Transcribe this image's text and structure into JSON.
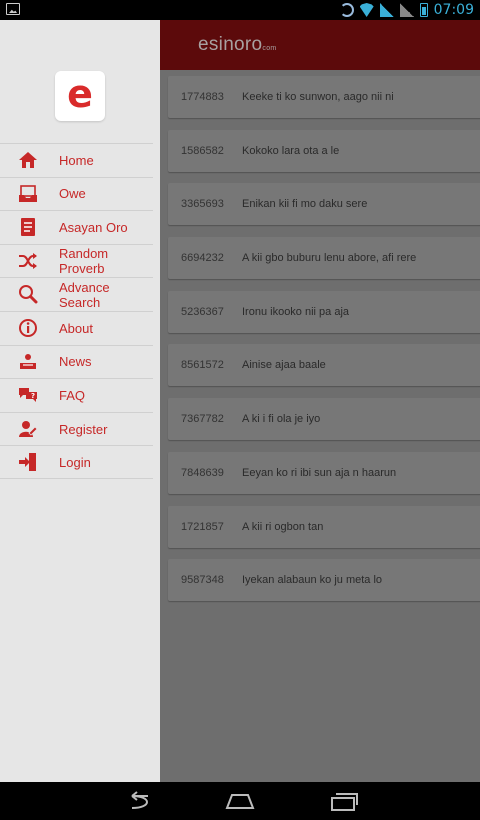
{
  "status": {
    "time": "07:09"
  },
  "app": {
    "brand_main": "esinoro",
    "brand_suffix": "com"
  },
  "drawer": {
    "logo_letter": "e",
    "items": [
      {
        "label": "Home",
        "icon": "home-icon"
      },
      {
        "label": "Owe",
        "icon": "inbox-icon"
      },
      {
        "label": "Asayan Oro",
        "icon": "list-icon"
      },
      {
        "label": "Random Proverb",
        "icon": "shuffle-icon"
      },
      {
        "label": "Advance Search",
        "icon": "search-icon"
      },
      {
        "label": "About",
        "icon": "info-icon"
      },
      {
        "label": "News",
        "icon": "news-icon"
      },
      {
        "label": "FAQ",
        "icon": "faq-icon"
      },
      {
        "label": "Register",
        "icon": "register-icon"
      },
      {
        "label": "Login",
        "icon": "login-icon"
      }
    ]
  },
  "proverbs": [
    {
      "id": "1774883",
      "text": "Keeke ti ko sunwon, aago nii ni"
    },
    {
      "id": "1586582",
      "text": "Kokoko lara ota a le"
    },
    {
      "id": "3365693",
      "text": "Enikan kii fi mo daku sere"
    },
    {
      "id": "6694232",
      "text": "A kii gbo buburu lenu abore, afi rere"
    },
    {
      "id": "5236367",
      "text": "Ironu ikooko nii pa aja"
    },
    {
      "id": "8561572",
      "text": "Ainise ajaa baale"
    },
    {
      "id": "7367782",
      "text": "A ki i fi ola je iyo"
    },
    {
      "id": "7848639",
      "text": "Eeyan ko ri ibi sun aja n haarun"
    },
    {
      "id": "1721857",
      "text": "A kii ri ogbon tan"
    },
    {
      "id": "9587348",
      "text": "Iyekan alabaun ko ju meta lo"
    }
  ],
  "colors": {
    "accent": "#c62828",
    "appbar": "#5c0a0b",
    "drawer_bg": "#e6e6e6"
  }
}
